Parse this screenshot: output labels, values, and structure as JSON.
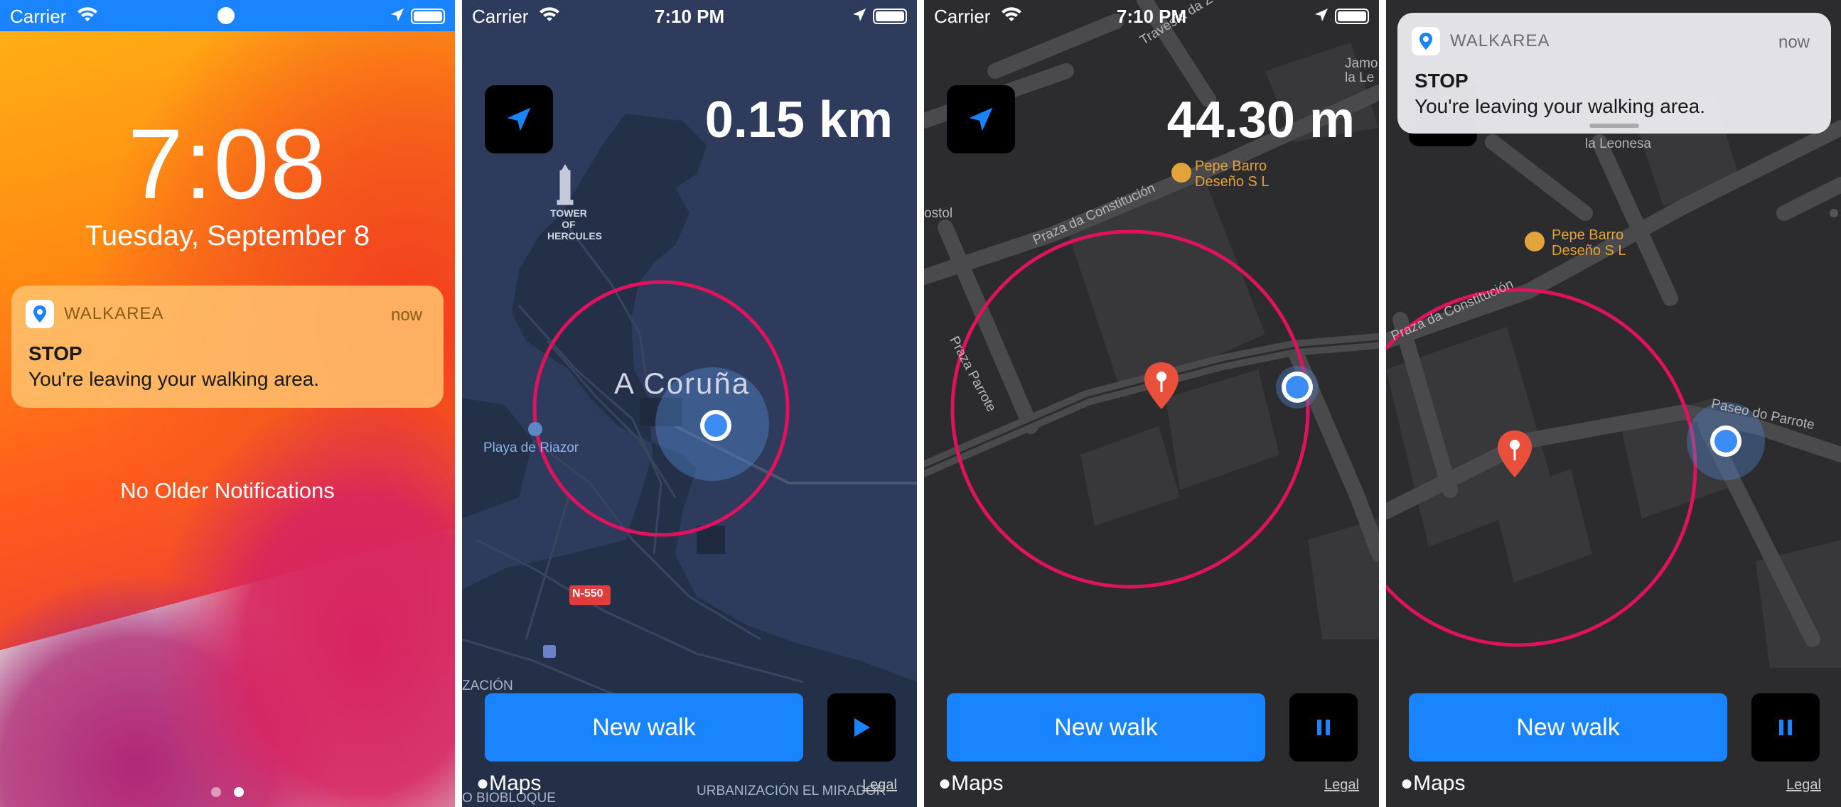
{
  "colors": {
    "accent": "#1a84ff",
    "circle": "#e0125e",
    "pin": "#e8503c",
    "user_dot": "#3b8cf5"
  },
  "lockscreen": {
    "status": {
      "carrier": "Carrier"
    },
    "time": "7:08",
    "date": "Tuesday, September 8",
    "notification": {
      "app": "WALKAREA",
      "when": "now",
      "title": "STOP",
      "body": "You're leaving your walking area."
    },
    "no_older": "No Older Notifications"
  },
  "screen2": {
    "status": {
      "carrier": "Carrier",
      "time": "7:10 PM"
    },
    "distance": "0.15 km",
    "city_label": "A Coruña",
    "labels": {
      "tower": "TOWER OF HERCULES",
      "beach": "Playa de Riazor",
      "road": "N-550",
      "urbanizacion": "ZACIÓN",
      "mirador": "URBANIZACIÓN EL MIRADOR",
      "biobloque": "O BIOBLOQUE"
    },
    "new_walk": "New walk",
    "maps": "Maps",
    "legal": "Legal"
  },
  "screen3": {
    "status": {
      "carrier": "Carrier",
      "time": "7:10 PM"
    },
    "distance": "44.30 m",
    "labels": {
      "poi": "Pepe Barro Deseño S L",
      "street1": "Praza da Constitución",
      "street2": "Praza Parrote",
      "street3": "Travesía da Zo",
      "edge1": "Jamo la Le",
      "edge2": "ostol"
    },
    "new_walk": "New walk",
    "maps": "Maps",
    "legal": "Legal"
  },
  "screen4": {
    "notification": {
      "app": "WALKAREA",
      "when": "now",
      "title": "STOP",
      "body": "You're leaving your walking area."
    },
    "labels": {
      "poi": "Pepe Barro Deseño S L",
      "street1": "Praza da Constitución",
      "street2": "Paseo do Parrote",
      "edge1": "la Leonesa"
    },
    "new_walk": "New walk",
    "maps": "Maps",
    "legal": "Legal"
  }
}
